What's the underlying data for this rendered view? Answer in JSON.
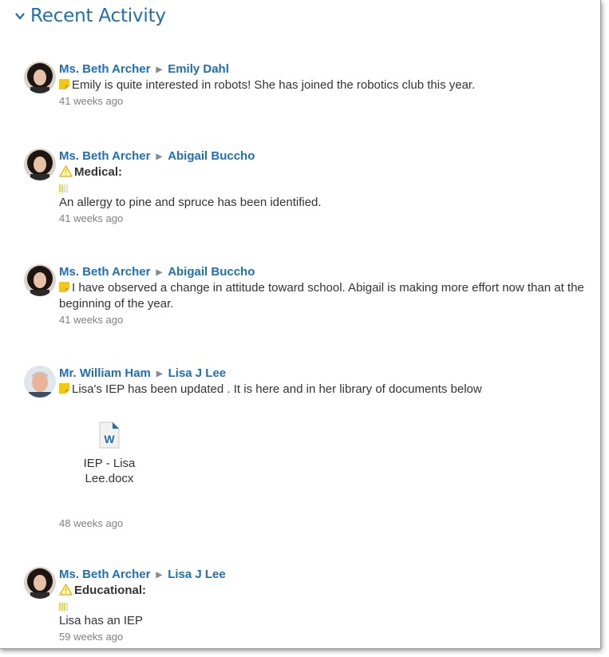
{
  "header": {
    "title": "Recent Activity"
  },
  "activities": [
    {
      "author": "Ms. Beth Archer",
      "target": "Emily Dahl",
      "text": "Emily is quite interested in robots! She has joined the robotics club this year.",
      "time": "41 weeks ago"
    },
    {
      "author": "Ms. Beth Archer",
      "target": "Abigail Buccho",
      "heading": "Medical:",
      "text": "An allergy to pine and spruce has been identified.",
      "time": "41 weeks ago"
    },
    {
      "author": "Ms. Beth Archer",
      "target": "Abigail Buccho",
      "text": "I have observed a change in attitude toward school. Abigail is making more effort now than at the beginning of the year.",
      "time": "41 weeks ago"
    },
    {
      "author": "Mr. William Ham",
      "target": "Lisa J Lee",
      "text": "Lisa's IEP has been updated .  It is here and in her library of documents below",
      "attachment": {
        "name": "IEP - Lisa Lee.docx",
        "icon": "word-doc-icon"
      },
      "time": "48 weeks ago"
    },
    {
      "author": "Ms. Beth Archer",
      "target": "Lisa J Lee",
      "heading": "Educational:",
      "text": "Lisa has an IEP",
      "time": "59 weeks ago"
    }
  ],
  "colors": {
    "link": "#1f6fb2",
    "note": "#f5c518",
    "warning": "#e8b80c",
    "muted": "#808080"
  }
}
